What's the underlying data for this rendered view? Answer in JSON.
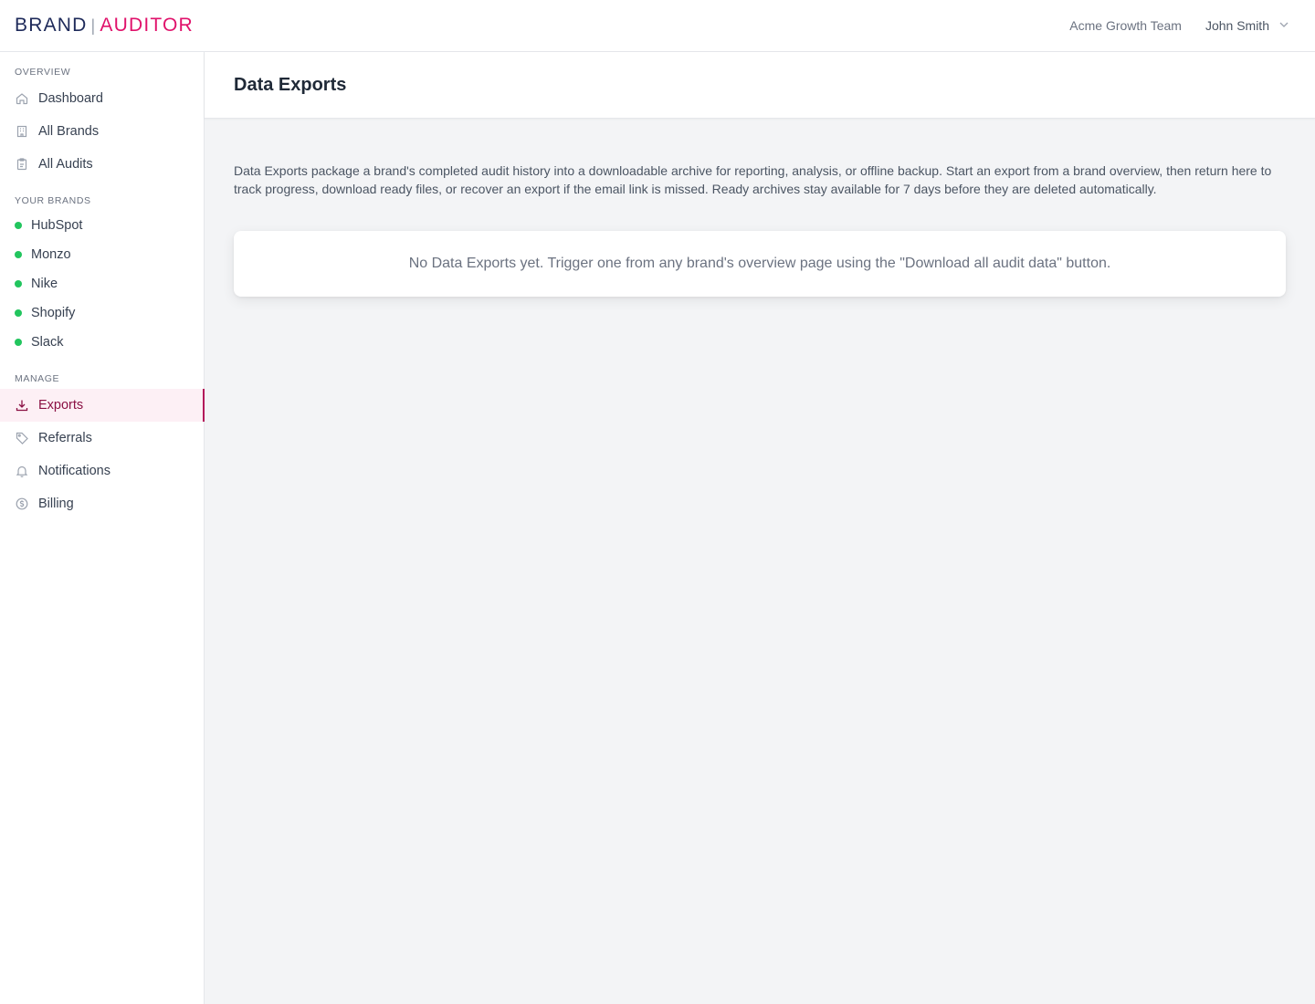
{
  "header": {
    "logo_left": "BRAND",
    "logo_sep": "|",
    "logo_right": "AUDITOR",
    "team_name": "Acme Growth Team",
    "user_name": "John Smith"
  },
  "sidebar": {
    "overview_label": "OVERVIEW",
    "overview_items": [
      {
        "label": "Dashboard",
        "icon": "home-icon"
      },
      {
        "label": "All Brands",
        "icon": "building-icon"
      },
      {
        "label": "All Audits",
        "icon": "clipboard-icon"
      }
    ],
    "brands_label": "YOUR BRANDS",
    "brands": [
      {
        "label": "HubSpot",
        "status_color": "#22c55e"
      },
      {
        "label": "Monzo",
        "status_color": "#22c55e"
      },
      {
        "label": "Nike",
        "status_color": "#22c55e"
      },
      {
        "label": "Shopify",
        "status_color": "#22c55e"
      },
      {
        "label": "Slack",
        "status_color": "#22c55e"
      }
    ],
    "manage_label": "MANAGE",
    "manage_items": [
      {
        "label": "Exports",
        "icon": "download-icon",
        "active": true
      },
      {
        "label": "Referrals",
        "icon": "tag-icon"
      },
      {
        "label": "Notifications",
        "icon": "bell-icon"
      },
      {
        "label": "Billing",
        "icon": "dollar-circle-icon"
      }
    ]
  },
  "main": {
    "title": "Data Exports",
    "description": "Data Exports package a brand's completed audit history into a downloadable archive for reporting, analysis, or offline backup. Start an export from a brand overview, then return here to track progress, download ready files, or recover an export if the email link is missed. Ready archives stay available for 7 days before they are deleted automatically.",
    "empty_message": "No Data Exports yet. Trigger one from any brand's overview page using the \"Download all audit data\" button."
  },
  "colors": {
    "brand_navy": "#1e2a5a",
    "brand_pink": "#e0126b",
    "active_accent": "#b3195a",
    "status_green": "#22c55e"
  }
}
